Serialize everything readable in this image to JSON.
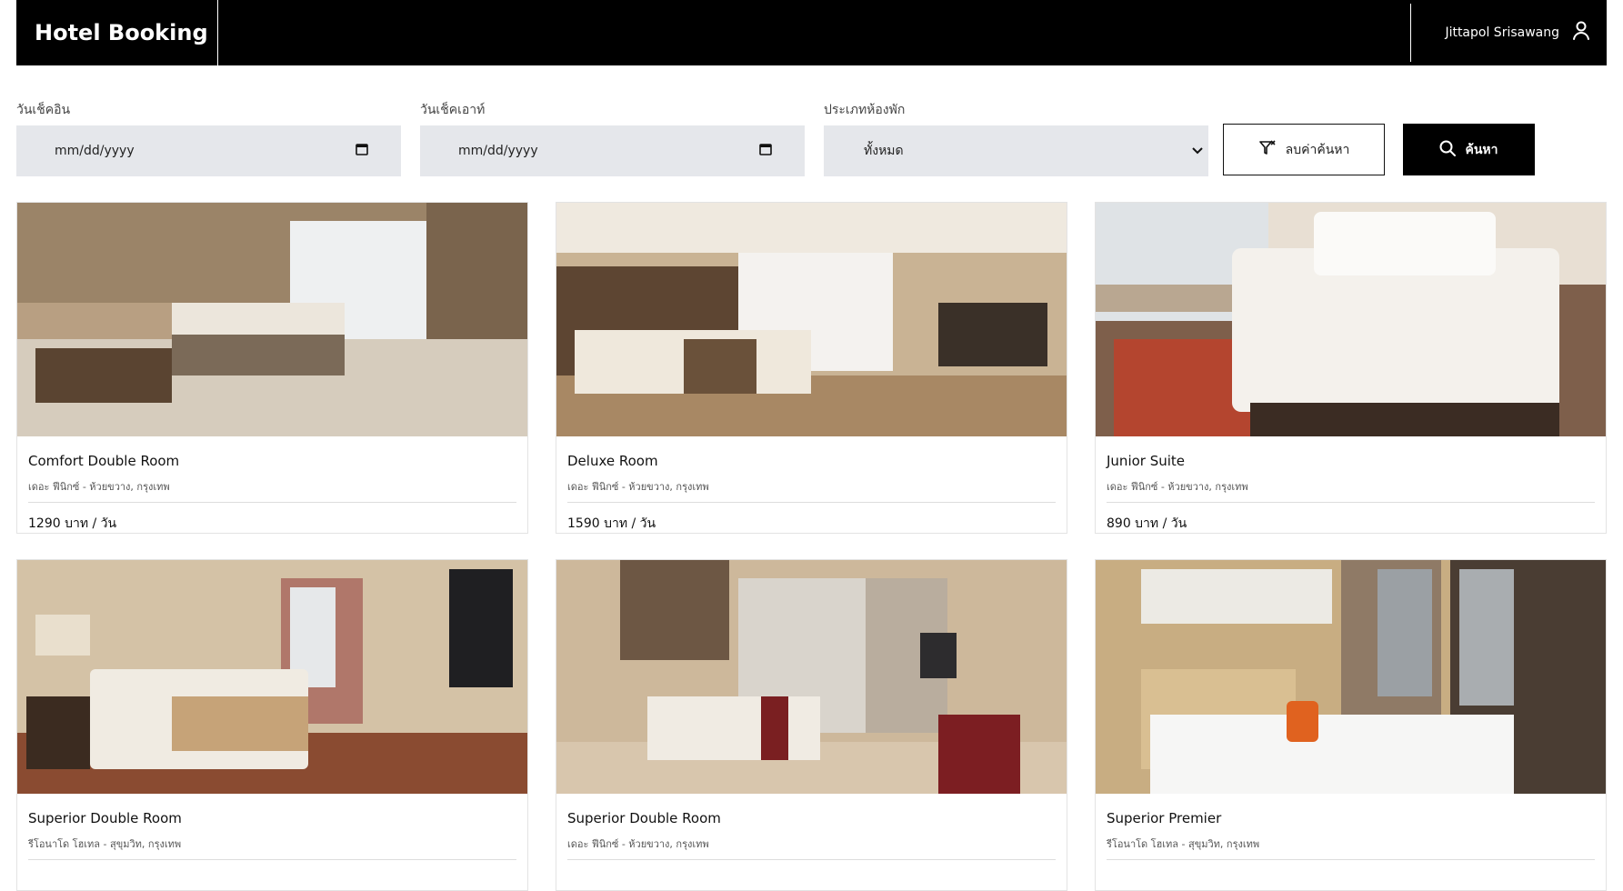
{
  "header": {
    "title": "Hotel Booking",
    "user_name": "Jittapol Srisawang"
  },
  "filters": {
    "checkin_label": "วันเช็คอิน",
    "checkin_value": "mm/dd/yyyy",
    "checkout_label": "วันเช็คเอาท์",
    "checkout_value": "mm/dd/yyyy",
    "roomtype_label": "ประเภทห้องพัก",
    "roomtype_value": "ทั้งหมด",
    "clear_label": "ลบค่าค้นหา",
    "search_label": "ค้นหา"
  },
  "rooms": [
    {
      "name": "Comfort Double Room",
      "location": "เดอะ ฟีนิกซ์ - ห้วยขวาง, กรุงเทพ",
      "price": "1290 บาท / วัน"
    },
    {
      "name": "Deluxe Room",
      "location": "เดอะ ฟีนิกซ์ - ห้วยขวาง, กรุงเทพ",
      "price": "1590 บาท / วัน"
    },
    {
      "name": "Junior Suite",
      "location": "เดอะ ฟีนิกซ์ - ห้วยขวาง, กรุงเทพ",
      "price": "890 บาท / วัน"
    },
    {
      "name": "Superior Double Room",
      "location": "รีโอนาโด โฮเทล - สุขุมวิท, กรุงเทพ",
      "price": ""
    },
    {
      "name": "Superior Double Room",
      "location": "เดอะ ฟีนิกซ์ - ห้วยขวาง, กรุงเทพ",
      "price": ""
    },
    {
      "name": "Superior Premier",
      "location": "รีโอนาโด โฮเทล - สุขุมวิท, กรุงเทพ",
      "price": ""
    }
  ],
  "icons": {
    "user": "user-icon",
    "calendar": "calendar-icon",
    "chevron": "chevron-down-icon",
    "filter_clear": "filter-clear-icon",
    "search": "search-icon"
  },
  "colors": {
    "header_bg": "#000000",
    "input_bg": "#e5e7eb",
    "search_button_bg": "#000000"
  }
}
